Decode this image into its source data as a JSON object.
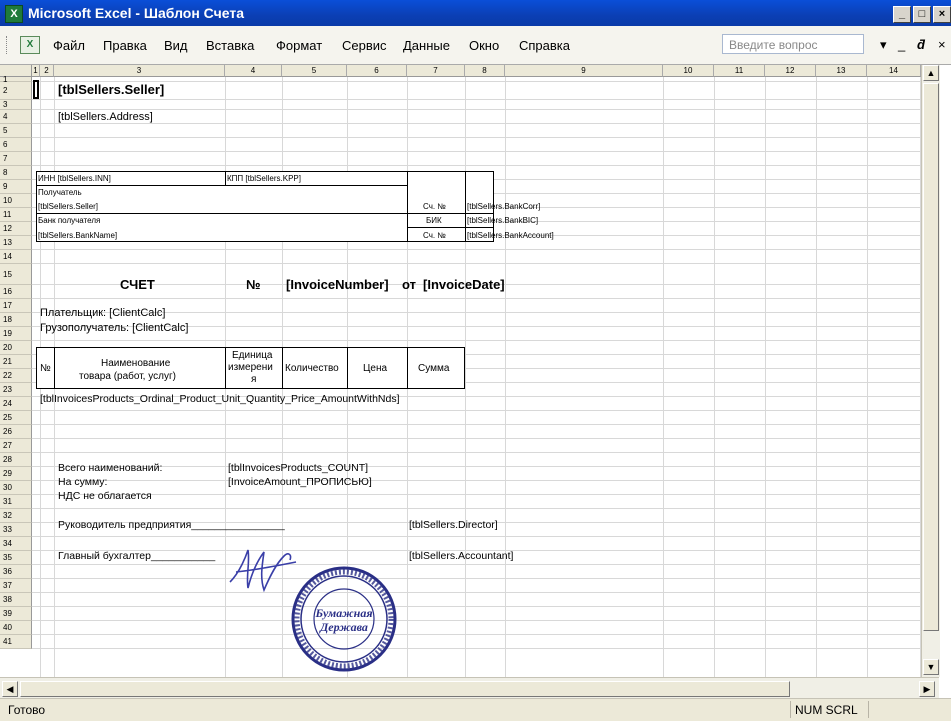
{
  "window": {
    "title": "Microsoft Excel - Шаблон Счета",
    "app_icon": "X"
  },
  "menu": {
    "items": [
      "Файл",
      "Правка",
      "Вид",
      "Вставка",
      "Формат",
      "Сервис",
      "Данные",
      "Окно",
      "Справка"
    ],
    "ask_placeholder": "Введите вопрос"
  },
  "columns": [
    "1",
    "2",
    "3",
    "4",
    "5",
    "6",
    "7",
    "8",
    "9",
    "10",
    "11",
    "12",
    "13",
    "14"
  ],
  "rows": [
    "1",
    "2",
    "3",
    "4",
    "5",
    "6",
    "7",
    "8",
    "9",
    "10",
    "11",
    "12",
    "13",
    "14",
    "15",
    "16",
    "17",
    "18",
    "19",
    "20",
    "21",
    "22",
    "23",
    "24",
    "25",
    "26",
    "27",
    "28",
    "29",
    "30",
    "31",
    "32",
    "33",
    "34",
    "35",
    "36",
    "37",
    "38",
    "39",
    "40",
    "41"
  ],
  "sheet": {
    "seller": "[tblSellers.Seller]",
    "address": "[tblSellers.Address]",
    "bank": {
      "inn": "ИНН [tblSellers.INN]",
      "kpp": "КПП [tblSellers.KPP]",
      "recipient_label": "Получатель",
      "recipient_value": "[tblSellers.Seller]",
      "acc_label_1": "Сч. №",
      "bank_corr": "[tblSellers.BankCorr]",
      "bank_recipient_label": "Банк получателя",
      "bik_label": "БИК",
      "bank_bic": "[tblSellers.BankBIC]",
      "bank_name": "[tblSellers.BankName]",
      "acc_label_2": "Сч. №",
      "bank_account": "[tblSellers.BankAccount]"
    },
    "invoice_title": "СЧЕТ",
    "number_sign": "№",
    "invoice_number": "[InvoiceNumber]",
    "from_word": "от",
    "invoice_date": "[InvoiceDate]",
    "payer": "Плательщик: [ClientCalc]",
    "consignee": "Грузополучатель: [ClientCalc]",
    "table_headers": {
      "num": "№",
      "name_1": "Наименование",
      "name_2": "товара (работ, услуг)",
      "unit_1": "Единица",
      "unit_2": "измерени",
      "unit_3": "я",
      "qty": "Количество",
      "price": "Цена",
      "sum": "Сумма"
    },
    "products_row": "[tblInvoicesProducts_Ordinal_Product_Unit_Quantity_Price_AmountWithNds]",
    "total_items_label": "Всего наименований:",
    "total_items_value": "[tblInvoicesProducts_COUNT]",
    "amount_label": "На сумму:",
    "amount_value": "[InvoiceAmount_ПРОПИСЬЮ]",
    "vat_note": "НДС не облагается",
    "director_label": "Руководитель предприятия________________",
    "director_value": "[tblSellers.Director]",
    "accountant_label": "Главный бухгалтер___________",
    "accountant_value": "[tblSellers.Accountant]",
    "stamp_text_1": "Бумажная",
    "stamp_text_2": "Держава"
  },
  "status": {
    "ready": "Готово",
    "indicators": "NUM SCRL"
  }
}
